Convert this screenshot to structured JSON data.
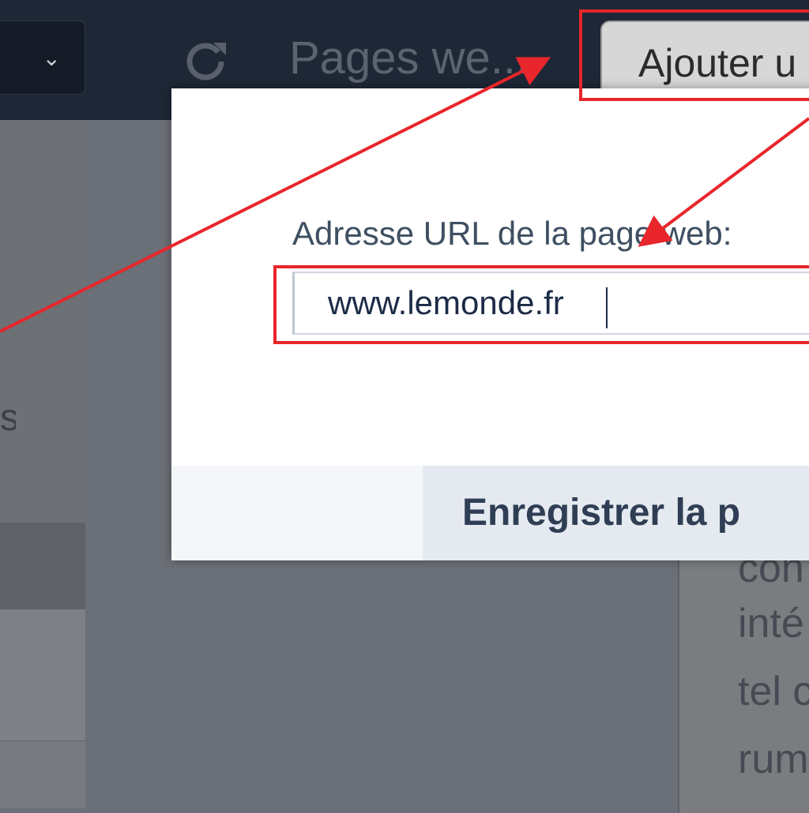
{
  "navbar": {
    "dropdown_icon": "chevron-down-icon",
    "reload_icon": "reload-icon",
    "title": "Pages we...",
    "add_button_label": "Ajouter u"
  },
  "sidebar": {
    "partial_text": "s"
  },
  "modal": {
    "url_label": "Adresse URL de la page web:",
    "url_value": "www.lemonde.fr",
    "save_button_label": "Enregistrer la p"
  },
  "background_text": {
    "lines": [
      "con",
      "inté",
      "tel c",
      "rum"
    ]
  },
  "annotations": {
    "color": "#e8262b"
  }
}
